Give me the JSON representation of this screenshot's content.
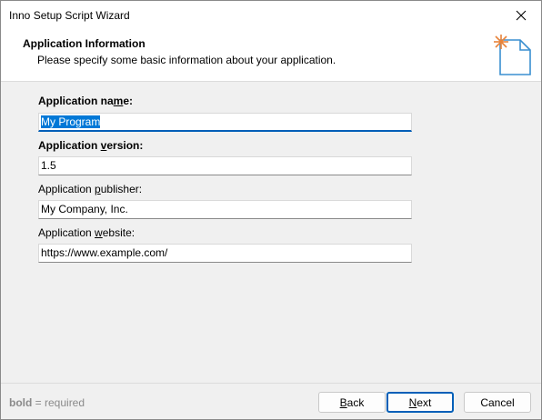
{
  "window": {
    "title": "Inno Setup Script Wizard"
  },
  "header": {
    "title": "Application Information",
    "subtitle": "Please specify some basic information about your application.",
    "icon": "wizard-document-icon"
  },
  "fields": [
    {
      "label_pre": "Application na",
      "label_ul": "m",
      "label_post": "e:",
      "required": true,
      "value": "My Program",
      "selected": true
    },
    {
      "label_pre": "Application ",
      "label_ul": "v",
      "label_post": "ersion:",
      "required": true,
      "value": "1.5"
    },
    {
      "label_pre": "Application ",
      "label_ul": "p",
      "label_post": "ublisher:",
      "required": false,
      "value": "My Company, Inc."
    },
    {
      "label_pre": "Application ",
      "label_ul": "w",
      "label_post": "ebsite:",
      "required": false,
      "value": "https://www.example.com/"
    }
  ],
  "footer": {
    "note_bold": "bold",
    "note_rest": " = required",
    "back": {
      "ul": "B",
      "rest": "ack"
    },
    "next": {
      "ul": "N",
      "rest": "ext"
    },
    "cancel": "Cancel"
  },
  "colors": {
    "accent": "#005fb8",
    "selection": "#0078d7",
    "star": "#e8833a",
    "doc_icon": "#3a8fd0"
  }
}
